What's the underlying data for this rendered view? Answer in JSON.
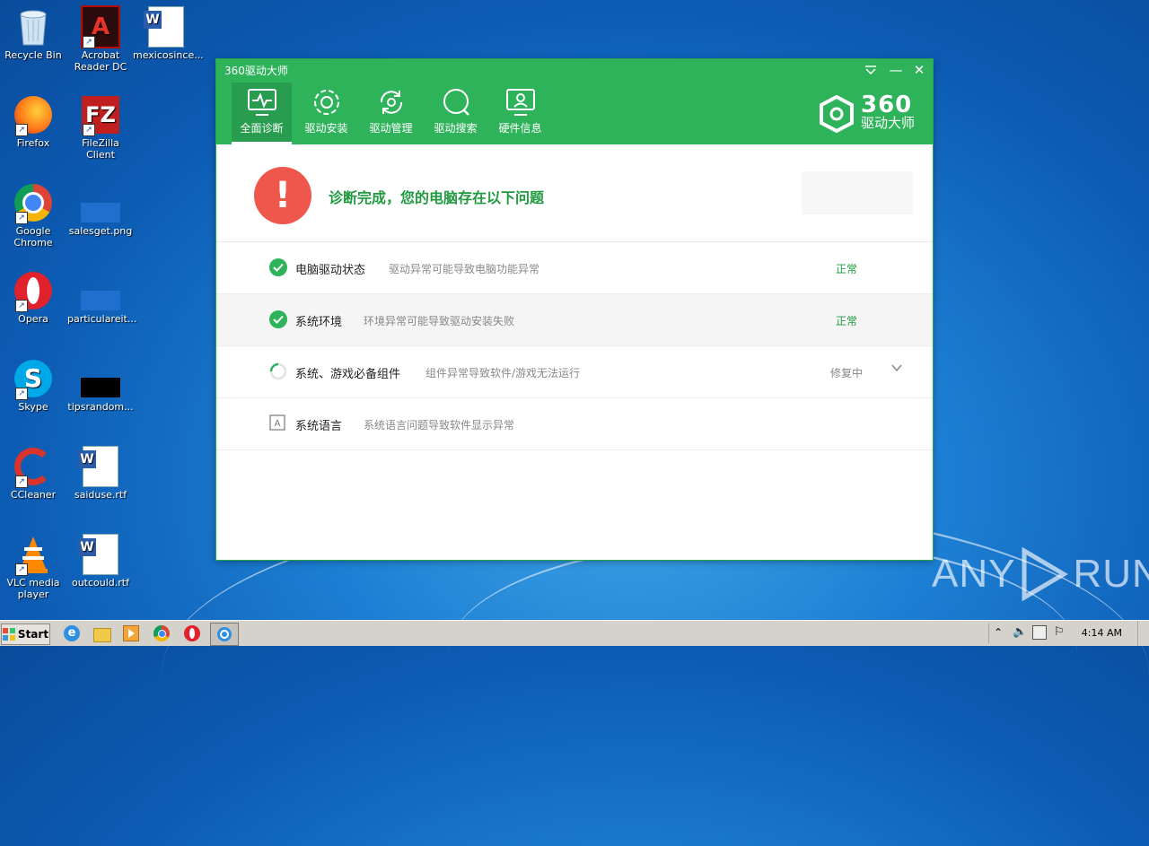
{
  "desktop": {
    "icons": [
      {
        "label": "Recycle Bin",
        "icon": "recycle-bin-icon"
      },
      {
        "label": "Acrobat Reader DC",
        "icon": "acrobat-icon"
      },
      {
        "label": "mexicosince...",
        "icon": "word-doc-icon"
      },
      {
        "label": "Firefox",
        "icon": "firefox-icon"
      },
      {
        "label": "FileZilla Client",
        "icon": "filezilla-icon"
      },
      {
        "label": "Google Chrome",
        "icon": "chrome-icon"
      },
      {
        "label": "salesget.png",
        "icon": "image-file-icon"
      },
      {
        "label": "Opera",
        "icon": "opera-icon"
      },
      {
        "label": "particulareit...",
        "icon": "image-file-icon"
      },
      {
        "label": "Skype",
        "icon": "skype-icon"
      },
      {
        "label": "tipsrandom...",
        "icon": "black-file-icon"
      },
      {
        "label": "CCleaner",
        "icon": "ccleaner-icon"
      },
      {
        "label": "saiduse.rtf",
        "icon": "word-doc-icon"
      },
      {
        "label": "VLC media player",
        "icon": "vlc-icon"
      },
      {
        "label": "outcould.rtf",
        "icon": "word-doc-icon"
      }
    ]
  },
  "window": {
    "title": "360驱动大师",
    "tabs": [
      {
        "label": "全面诊断",
        "icon": "monitor-pulse-icon",
        "active": true
      },
      {
        "label": "驱动安装",
        "icon": "gear-icon",
        "active": false
      },
      {
        "label": "驱动管理",
        "icon": "refresh-gear-icon",
        "active": false
      },
      {
        "label": "驱动搜索",
        "icon": "search-icon",
        "active": false
      },
      {
        "label": "硬件信息",
        "icon": "hardware-monitor-icon",
        "active": false
      }
    ],
    "brand": {
      "number": "360",
      "name": "驱动大师"
    },
    "diagnosis": {
      "title": "诊断完成，您的电脑存在以下问题",
      "alert_symbol": "!"
    },
    "items": [
      {
        "name": "电脑驱动状态",
        "desc": "驱动异常可能导致电脑功能异常",
        "status": "正常",
        "icon": "check-circle-icon"
      },
      {
        "name": "系统环境",
        "desc": "环境异常可能导致驱动安装失败",
        "status": "正常",
        "icon": "check-circle-icon"
      },
      {
        "name": "系统、游戏必备组件",
        "desc": "组件异常导致软件/游戏无法运行",
        "status": "修复中",
        "icon": "loading-spinner-icon"
      },
      {
        "name": "系统语言",
        "desc": "系统语言问题导致软件显示异常",
        "status": "",
        "icon": "language-icon"
      }
    ]
  },
  "taskbar": {
    "start_label": "Start",
    "clock": "4:14 AM"
  },
  "watermark": {
    "left": "ANY",
    "right": "RUN"
  },
  "colors": {
    "brand_green": "#2fb35a",
    "alert_red": "#f0574c",
    "ok_green": "#1f9a3f"
  }
}
